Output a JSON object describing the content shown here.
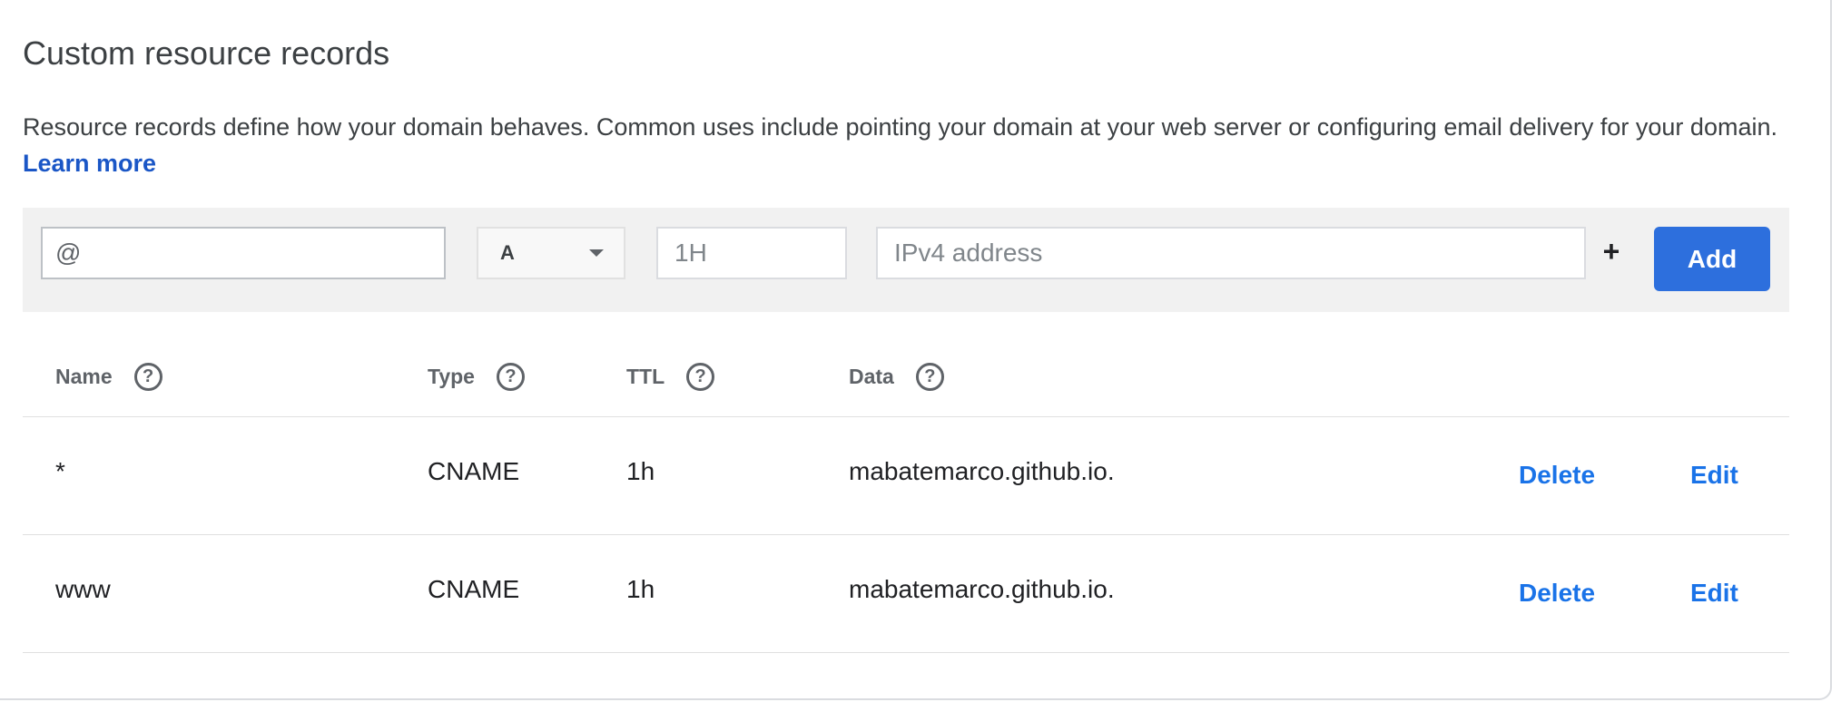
{
  "section": {
    "title": "Custom resource records",
    "description": "Resource records define how your domain behaves. Common uses include pointing your domain at your web server or configuring email delivery for your domain.",
    "learn_more": "Learn more"
  },
  "add_form": {
    "name_value": "@",
    "type_value": "A",
    "ttl_placeholder": "1H",
    "data_placeholder": "IPv4 address",
    "plus_label": "+",
    "add_label": "Add"
  },
  "table": {
    "headers": {
      "name": "Name",
      "type": "Type",
      "ttl": "TTL",
      "data": "Data"
    },
    "help_glyph": "?",
    "rows": [
      {
        "name": "*",
        "type": "CNAME",
        "ttl": "1h",
        "data": "mabatemarco.github.io.",
        "delete": "Delete",
        "edit": "Edit"
      },
      {
        "name": "www",
        "type": "CNAME",
        "ttl": "1h",
        "data": "mabatemarco.github.io.",
        "delete": "Delete",
        "edit": "Edit"
      }
    ]
  },
  "colors": {
    "accent": "#1a73e8",
    "button": "#2d6fdd",
    "link": "#1a56c6"
  }
}
